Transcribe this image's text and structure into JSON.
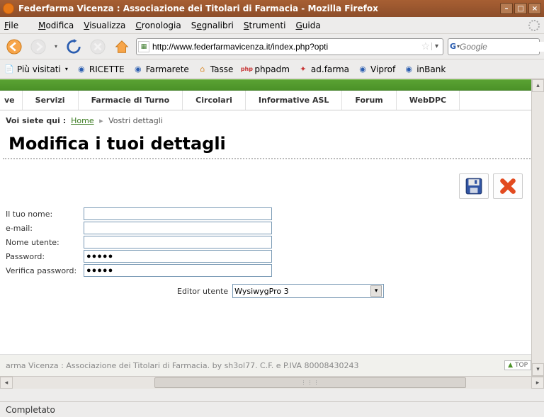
{
  "window": {
    "title": "Federfarma Vicenza : Associazione dei Titolari di Farmacia - Mozilla Firefox"
  },
  "menubar": {
    "file": "File",
    "modifica": "Modifica",
    "visualizza": "Visualizza",
    "cronologia": "Cronologia",
    "segnalibri": "Segnalibri",
    "strumenti": "Strumenti",
    "guida": "Guida"
  },
  "nav": {
    "url": "http://www.federfarmavicenza.it/index.php?opti",
    "search_placeholder": "Google"
  },
  "bookmarks": [
    {
      "label": "Più visitati",
      "icon": "📄",
      "dropdown": true
    },
    {
      "label": "RICETTE",
      "icon": "◉"
    },
    {
      "label": "Farmarete",
      "icon": "◉"
    },
    {
      "label": "Tasse",
      "icon": "⌂"
    },
    {
      "label": "phpadm",
      "icon": "php"
    },
    {
      "label": "ad.farma",
      "icon": "✦"
    },
    {
      "label": "Viprof",
      "icon": "◉"
    },
    {
      "label": "inBank",
      "icon": "◉"
    }
  ],
  "sitenav": [
    "ve",
    "Servizi",
    "Farmacie di Turno",
    "Circolari",
    "Informative ASL",
    "Forum",
    "WebDPC"
  ],
  "breadcrumb": {
    "prefix": "Voi siete qui :",
    "home": "Home",
    "current": "Vostri dettagli"
  },
  "page": {
    "title": "Modifica i tuoi dettagli"
  },
  "form": {
    "name_label": "Il tuo nome:",
    "name_value": "",
    "email_label": "e-mail:",
    "email_value": "",
    "username_label": "Nome utente:",
    "username_value": "",
    "password_label": "Password:",
    "password_value": "●●●●●",
    "verify_label": "Verifica password:",
    "verify_value": "●●●●●",
    "editor_label": "Editor utente",
    "editor_value": "WysiwygPro 3"
  },
  "footer_text": "arma Vicenza : Associazione dei Titolari di Farmacia. by sh3ol77. C.F. e P.IVA 80008430243",
  "top_btn": "TOP",
  "status": "Completato"
}
